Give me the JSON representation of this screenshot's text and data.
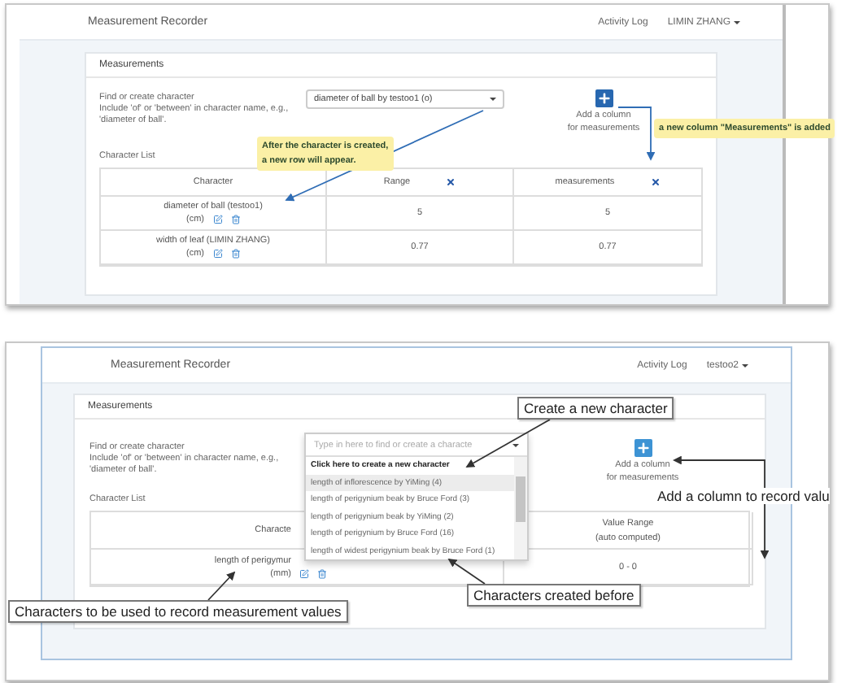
{
  "panels": [
    {
      "header": {
        "title": "Measurement Recorder",
        "link": "Activity Log",
        "user": "LIMIN ZHANG"
      },
      "card_title": "Measurements",
      "find_label": [
        "Find or create character",
        "Include 'of' or 'between' in character name, e.g.,",
        "'diameter of ball'."
      ],
      "select": {
        "value": "diameter of ball by testoo1 (o)",
        "open": false
      },
      "add_column": [
        "Add a column",
        "for measurements"
      ],
      "list_label": "Character List",
      "table": {
        "columns": [
          {
            "label": "Character",
            "removable": false
          },
          {
            "label": "Range",
            "removable": true
          },
          {
            "label": "measurements",
            "removable": true
          }
        ],
        "rows": [
          {
            "cells": [
              {
                "text": "diameter of ball (testoo1)",
                "unit": "(cm)"
              },
              {
                "text": "5"
              },
              {
                "text": "5"
              }
            ]
          },
          {
            "cells": [
              {
                "text": "width of leaf (LIMIN ZHANG)",
                "unit": "(cm)"
              },
              {
                "text": "0.77"
              },
              {
                "text": "0.77"
              }
            ]
          }
        ]
      },
      "callouts": [
        {
          "kind": "yellow",
          "lines": [
            "After the character is created,",
            "a new row will appear."
          ]
        },
        {
          "kind": "yellow",
          "lines": [
            "a new column \"Measurements\" is added"
          ]
        }
      ]
    },
    {
      "header": {
        "title": "Measurement Recorder",
        "link": "Activity Log",
        "user": "testoo2"
      },
      "card_title": "Measurements",
      "find_label": [
        "Find or create character",
        "Include 'of' or 'between' in character name, e.g.,",
        "'diameter of ball'."
      ],
      "select": {
        "placeholder": "Type in here to find or create a characte",
        "open": true,
        "options": [
          {
            "label": "Click here to create a new character",
            "kind": "create",
            "selected": false
          },
          {
            "label": "length of inflorescence by YiMing (4)",
            "kind": "item",
            "selected": true
          },
          {
            "label": "length of perigynium beak by Bruce Ford (3)",
            "kind": "item",
            "selected": false
          },
          {
            "label": "length of perigynium beak by YiMing (2)",
            "kind": "item",
            "selected": false
          },
          {
            "label": "length of perigynium by Bruce Ford (16)",
            "kind": "item",
            "selected": false
          },
          {
            "label": "length of widest perigynium beak by Bruce Ford (1)",
            "kind": "item",
            "selected": false
          }
        ]
      },
      "add_column": [
        "Add a column",
        "for measurements"
      ],
      "list_label": "Character List",
      "table": {
        "columns": [
          {
            "label": "Characte",
            "removable": false
          },
          {
            "label": "Value Range",
            "sublabel": "(auto computed)",
            "removable": false
          }
        ],
        "rows": [
          {
            "cells": [
              {
                "text": "length of perigymur",
                "unit": "(mm)"
              },
              {
                "text": "0 - 0"
              }
            ]
          }
        ]
      },
      "callouts": [
        {
          "kind": "boxed",
          "lines": [
            "Create a new character"
          ]
        },
        {
          "kind": "plain",
          "lines": [
            "Add a column to record valu"
          ]
        },
        {
          "kind": "boxed",
          "lines": [
            "Characters created before"
          ]
        },
        {
          "kind": "boxed",
          "lines": [
            "Characters to be used to record measurement values"
          ]
        }
      ]
    }
  ]
}
